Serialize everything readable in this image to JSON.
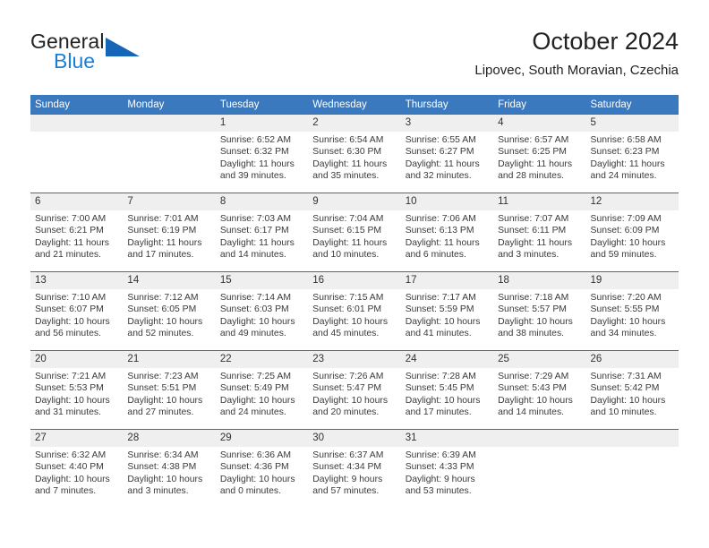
{
  "brand": {
    "name_part1": "General",
    "name_part2": "Blue",
    "logo_icon": "triangle-logo-icon"
  },
  "header": {
    "month_title": "October 2024",
    "location": "Lipovec, South Moravian, Czechia"
  },
  "calendar": {
    "accent_color": "#3a79bd",
    "daynum_bg": "#efefef",
    "weekday_headers": [
      "Sunday",
      "Monday",
      "Tuesday",
      "Wednesday",
      "Thursday",
      "Friday",
      "Saturday"
    ],
    "weeks": [
      [
        {
          "day": "",
          "sunrise": "",
          "sunset": "",
          "daylight_line1": "",
          "daylight_line2": "",
          "empty": true
        },
        {
          "day": "",
          "sunrise": "",
          "sunset": "",
          "daylight_line1": "",
          "daylight_line2": "",
          "empty": true
        },
        {
          "day": "1",
          "sunrise": "Sunrise: 6:52 AM",
          "sunset": "Sunset: 6:32 PM",
          "daylight_line1": "Daylight: 11 hours",
          "daylight_line2": "and 39 minutes.",
          "empty": false
        },
        {
          "day": "2",
          "sunrise": "Sunrise: 6:54 AM",
          "sunset": "Sunset: 6:30 PM",
          "daylight_line1": "Daylight: 11 hours",
          "daylight_line2": "and 35 minutes.",
          "empty": false
        },
        {
          "day": "3",
          "sunrise": "Sunrise: 6:55 AM",
          "sunset": "Sunset: 6:27 PM",
          "daylight_line1": "Daylight: 11 hours",
          "daylight_line2": "and 32 minutes.",
          "empty": false
        },
        {
          "day": "4",
          "sunrise": "Sunrise: 6:57 AM",
          "sunset": "Sunset: 6:25 PM",
          "daylight_line1": "Daylight: 11 hours",
          "daylight_line2": "and 28 minutes.",
          "empty": false
        },
        {
          "day": "5",
          "sunrise": "Sunrise: 6:58 AM",
          "sunset": "Sunset: 6:23 PM",
          "daylight_line1": "Daylight: 11 hours",
          "daylight_line2": "and 24 minutes.",
          "empty": false
        }
      ],
      [
        {
          "day": "6",
          "sunrise": "Sunrise: 7:00 AM",
          "sunset": "Sunset: 6:21 PM",
          "daylight_line1": "Daylight: 11 hours",
          "daylight_line2": "and 21 minutes.",
          "empty": false
        },
        {
          "day": "7",
          "sunrise": "Sunrise: 7:01 AM",
          "sunset": "Sunset: 6:19 PM",
          "daylight_line1": "Daylight: 11 hours",
          "daylight_line2": "and 17 minutes.",
          "empty": false
        },
        {
          "day": "8",
          "sunrise": "Sunrise: 7:03 AM",
          "sunset": "Sunset: 6:17 PM",
          "daylight_line1": "Daylight: 11 hours",
          "daylight_line2": "and 14 minutes.",
          "empty": false
        },
        {
          "day": "9",
          "sunrise": "Sunrise: 7:04 AM",
          "sunset": "Sunset: 6:15 PM",
          "daylight_line1": "Daylight: 11 hours",
          "daylight_line2": "and 10 minutes.",
          "empty": false
        },
        {
          "day": "10",
          "sunrise": "Sunrise: 7:06 AM",
          "sunset": "Sunset: 6:13 PM",
          "daylight_line1": "Daylight: 11 hours",
          "daylight_line2": "and 6 minutes.",
          "empty": false
        },
        {
          "day": "11",
          "sunrise": "Sunrise: 7:07 AM",
          "sunset": "Sunset: 6:11 PM",
          "daylight_line1": "Daylight: 11 hours",
          "daylight_line2": "and 3 minutes.",
          "empty": false
        },
        {
          "day": "12",
          "sunrise": "Sunrise: 7:09 AM",
          "sunset": "Sunset: 6:09 PM",
          "daylight_line1": "Daylight: 10 hours",
          "daylight_line2": "and 59 minutes.",
          "empty": false
        }
      ],
      [
        {
          "day": "13",
          "sunrise": "Sunrise: 7:10 AM",
          "sunset": "Sunset: 6:07 PM",
          "daylight_line1": "Daylight: 10 hours",
          "daylight_line2": "and 56 minutes.",
          "empty": false
        },
        {
          "day": "14",
          "sunrise": "Sunrise: 7:12 AM",
          "sunset": "Sunset: 6:05 PM",
          "daylight_line1": "Daylight: 10 hours",
          "daylight_line2": "and 52 minutes.",
          "empty": false
        },
        {
          "day": "15",
          "sunrise": "Sunrise: 7:14 AM",
          "sunset": "Sunset: 6:03 PM",
          "daylight_line1": "Daylight: 10 hours",
          "daylight_line2": "and 49 minutes.",
          "empty": false
        },
        {
          "day": "16",
          "sunrise": "Sunrise: 7:15 AM",
          "sunset": "Sunset: 6:01 PM",
          "daylight_line1": "Daylight: 10 hours",
          "daylight_line2": "and 45 minutes.",
          "empty": false
        },
        {
          "day": "17",
          "sunrise": "Sunrise: 7:17 AM",
          "sunset": "Sunset: 5:59 PM",
          "daylight_line1": "Daylight: 10 hours",
          "daylight_line2": "and 41 minutes.",
          "empty": false
        },
        {
          "day": "18",
          "sunrise": "Sunrise: 7:18 AM",
          "sunset": "Sunset: 5:57 PM",
          "daylight_line1": "Daylight: 10 hours",
          "daylight_line2": "and 38 minutes.",
          "empty": false
        },
        {
          "day": "19",
          "sunrise": "Sunrise: 7:20 AM",
          "sunset": "Sunset: 5:55 PM",
          "daylight_line1": "Daylight: 10 hours",
          "daylight_line2": "and 34 minutes.",
          "empty": false
        }
      ],
      [
        {
          "day": "20",
          "sunrise": "Sunrise: 7:21 AM",
          "sunset": "Sunset: 5:53 PM",
          "daylight_line1": "Daylight: 10 hours",
          "daylight_line2": "and 31 minutes.",
          "empty": false
        },
        {
          "day": "21",
          "sunrise": "Sunrise: 7:23 AM",
          "sunset": "Sunset: 5:51 PM",
          "daylight_line1": "Daylight: 10 hours",
          "daylight_line2": "and 27 minutes.",
          "empty": false
        },
        {
          "day": "22",
          "sunrise": "Sunrise: 7:25 AM",
          "sunset": "Sunset: 5:49 PM",
          "daylight_line1": "Daylight: 10 hours",
          "daylight_line2": "and 24 minutes.",
          "empty": false
        },
        {
          "day": "23",
          "sunrise": "Sunrise: 7:26 AM",
          "sunset": "Sunset: 5:47 PM",
          "daylight_line1": "Daylight: 10 hours",
          "daylight_line2": "and 20 minutes.",
          "empty": false
        },
        {
          "day": "24",
          "sunrise": "Sunrise: 7:28 AM",
          "sunset": "Sunset: 5:45 PM",
          "daylight_line1": "Daylight: 10 hours",
          "daylight_line2": "and 17 minutes.",
          "empty": false
        },
        {
          "day": "25",
          "sunrise": "Sunrise: 7:29 AM",
          "sunset": "Sunset: 5:43 PM",
          "daylight_line1": "Daylight: 10 hours",
          "daylight_line2": "and 14 minutes.",
          "empty": false
        },
        {
          "day": "26",
          "sunrise": "Sunrise: 7:31 AM",
          "sunset": "Sunset: 5:42 PM",
          "daylight_line1": "Daylight: 10 hours",
          "daylight_line2": "and 10 minutes.",
          "empty": false
        }
      ],
      [
        {
          "day": "27",
          "sunrise": "Sunrise: 6:32 AM",
          "sunset": "Sunset: 4:40 PM",
          "daylight_line1": "Daylight: 10 hours",
          "daylight_line2": "and 7 minutes.",
          "empty": false
        },
        {
          "day": "28",
          "sunrise": "Sunrise: 6:34 AM",
          "sunset": "Sunset: 4:38 PM",
          "daylight_line1": "Daylight: 10 hours",
          "daylight_line2": "and 3 minutes.",
          "empty": false
        },
        {
          "day": "29",
          "sunrise": "Sunrise: 6:36 AM",
          "sunset": "Sunset: 4:36 PM",
          "daylight_line1": "Daylight: 10 hours",
          "daylight_line2": "and 0 minutes.",
          "empty": false
        },
        {
          "day": "30",
          "sunrise": "Sunrise: 6:37 AM",
          "sunset": "Sunset: 4:34 PM",
          "daylight_line1": "Daylight: 9 hours",
          "daylight_line2": "and 57 minutes.",
          "empty": false
        },
        {
          "day": "31",
          "sunrise": "Sunrise: 6:39 AM",
          "sunset": "Sunset: 4:33 PM",
          "daylight_line1": "Daylight: 9 hours",
          "daylight_line2": "and 53 minutes.",
          "empty": false
        },
        {
          "day": "",
          "sunrise": "",
          "sunset": "",
          "daylight_line1": "",
          "daylight_line2": "",
          "empty": true
        },
        {
          "day": "",
          "sunrise": "",
          "sunset": "",
          "daylight_line1": "",
          "daylight_line2": "",
          "empty": true
        }
      ]
    ]
  }
}
